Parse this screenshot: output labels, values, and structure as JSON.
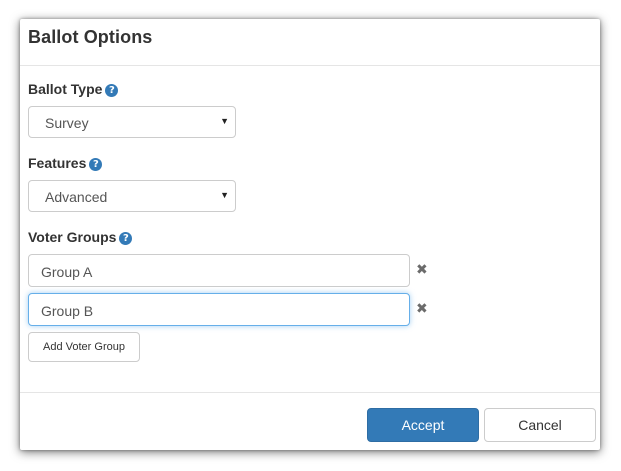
{
  "dialog": {
    "title": "Ballot Options"
  },
  "ballot_type": {
    "label": "Ballot Type",
    "help_icon": "?",
    "selected": "Survey",
    "caret": "▼"
  },
  "features": {
    "label": "Features",
    "help_icon": "?",
    "selected": "Advanced",
    "caret": "▼"
  },
  "voter_groups": {
    "label": "Voter Groups",
    "help_icon": "?",
    "items": [
      {
        "value": "Group A",
        "remove": "✖"
      },
      {
        "value": "Group B",
        "remove": "✖"
      }
    ],
    "add_label": "Add Voter Group"
  },
  "footer": {
    "accept_label": "Accept",
    "cancel_label": "Cancel"
  },
  "colors": {
    "primary": "#337ab7",
    "focus_border": "#66afe9",
    "help_icon": "#337ab7"
  },
  "icons": {
    "help": "question-circle-icon",
    "remove": "times-icon",
    "caret": "caret-down-icon"
  }
}
